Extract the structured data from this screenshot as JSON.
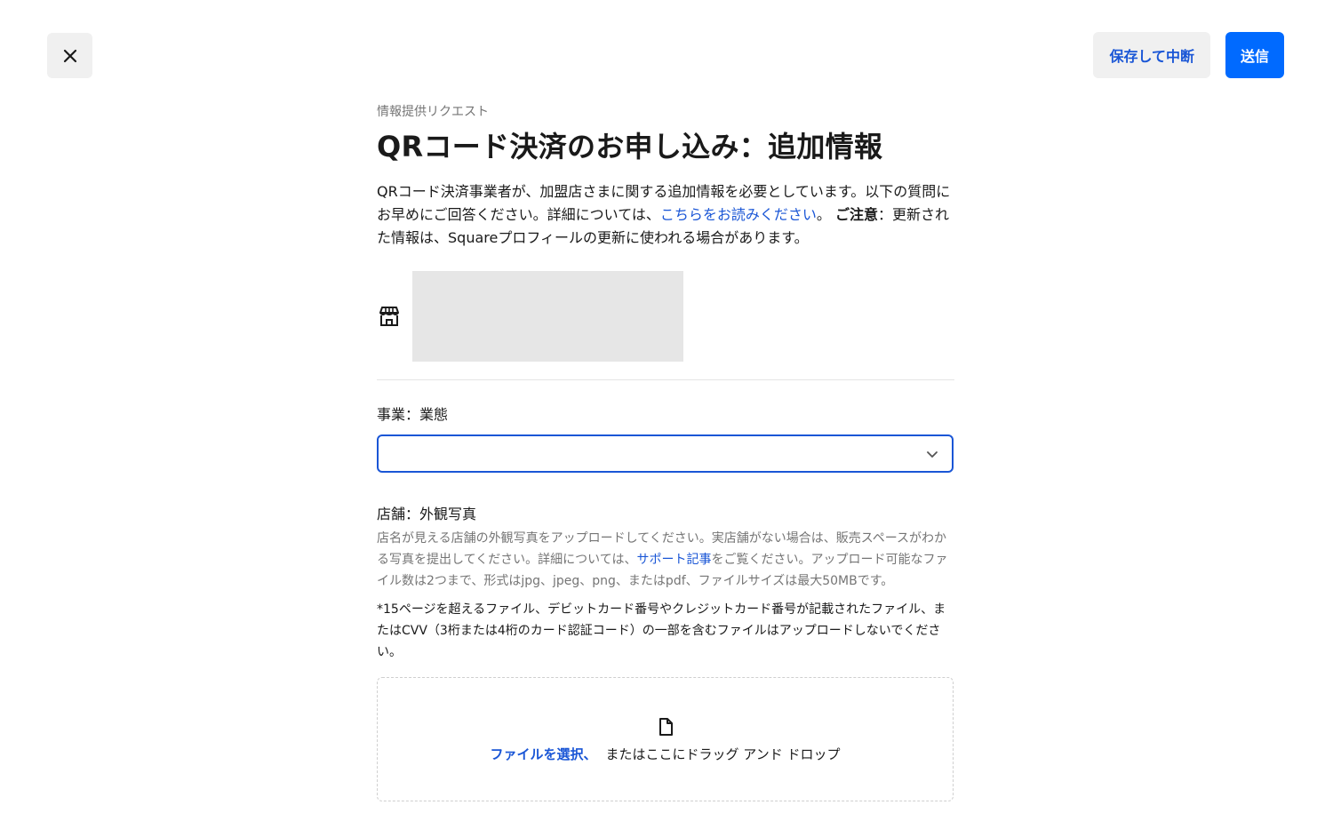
{
  "header": {
    "close_icon": "close-icon",
    "save_label": "保存して中断",
    "submit_label": "送信"
  },
  "main": {
    "eyebrow": "情報提供リクエスト",
    "title": "QRコード決済のお申し込み：追加情報",
    "intro": {
      "text1": "QRコード決済事業者が、加盟店さまに関する追加情報を必要としています。以下の質問にお早めにご回答ください。詳細については、",
      "link": "こちらをお読みください",
      "text2": "。 ",
      "bold": "ご注意",
      "text3": "：更新された情報は、Squareプロフィールの更新に使われる場合があります。"
    },
    "store_icon": "storefront-icon"
  },
  "fields": {
    "business_type": {
      "label": "事業：業態",
      "value": ""
    },
    "exterior_photo": {
      "label": "店舗：外観写真",
      "help_text1": "店名が見える店舗の外観写真をアップロードしてください。実店舗がない場合は、販売スペースがわかる写真を提出してください。詳細については、",
      "help_link": "サポート記事",
      "help_text2": "をご覧ください。アップロード可能なファイル数は2つまで、形式はjpg、jpeg、png、またはpdf、ファイルサイズは最大50MBです。",
      "warning": "*15ページを超えるファイル、デビットカード番号やクレジットカード番号が記載されたファイル、またはCVV（3桁または4桁のカード認証コード）の一部を含むファイルはアップロードしないでください。",
      "dropzone_link": "ファイルを選択、",
      "dropzone_text": "またはここにドラッグ アンド ドロップ",
      "dropzone_icon": "file-icon"
    }
  },
  "colors": {
    "accent": "#006aff",
    "link": "#1a56d6",
    "muted": "#757575",
    "button_bg": "#f0f0f0"
  }
}
